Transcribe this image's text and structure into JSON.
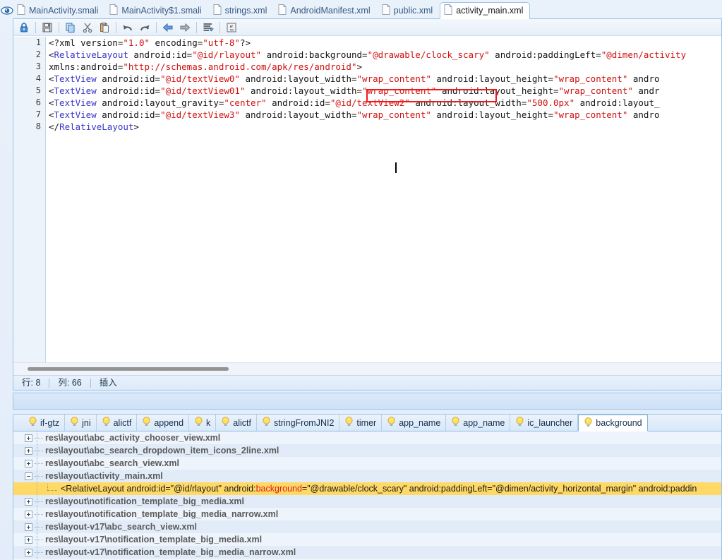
{
  "window": {
    "eye_icon": "eye-icon"
  },
  "tabbar": {
    "tabs": [
      {
        "label": "MainActivity.smali",
        "icon": "file-icon",
        "active": false
      },
      {
        "label": "MainActivity$1.smali",
        "icon": "file-icon",
        "active": false
      },
      {
        "label": "strings.xml",
        "icon": "file-icon",
        "active": false
      },
      {
        "label": "AndroidManifest.xml",
        "icon": "file-icon",
        "active": false
      },
      {
        "label": "public.xml",
        "icon": "file-icon",
        "active": false
      },
      {
        "label": "activity_main.xml",
        "icon": "file-icon",
        "active": true
      }
    ]
  },
  "toolbar": {
    "buttons": [
      {
        "name": "lock-icon",
        "title": "Lock"
      },
      {
        "name": "save-icon",
        "title": "Save"
      },
      {
        "name": "copy-icon",
        "title": "Copy"
      },
      {
        "name": "cut-icon",
        "title": "Cut"
      },
      {
        "name": "paste-icon",
        "title": "Paste"
      },
      {
        "name": "undo-icon",
        "title": "Undo"
      },
      {
        "name": "redo-icon",
        "title": "Redo"
      },
      {
        "name": "back-arrow-icon",
        "title": "Back"
      },
      {
        "name": "forward-arrow-icon",
        "title": "Forward"
      },
      {
        "name": "format-lines-icon",
        "title": "Format"
      },
      {
        "name": "java-icon",
        "title": "Java"
      }
    ]
  },
  "editor": {
    "line_numbers": [
      "1",
      "2",
      "3",
      "4",
      "5",
      "6",
      "7",
      "8"
    ],
    "lines": [
      {
        "n": "1",
        "tokens": [
          {
            "t": "decl",
            "v": "<?xml "
          },
          {
            "t": "attr",
            "v": "version="
          },
          {
            "t": "str",
            "v": "\"1.0\""
          },
          {
            "t": "attr",
            "v": " encoding="
          },
          {
            "t": "str",
            "v": "\"utf-8\""
          },
          {
            "t": "decl",
            "v": "?>"
          }
        ]
      },
      {
        "n": "2",
        "tokens": [
          {
            "t": "punc",
            "v": "<"
          },
          {
            "t": "tag",
            "v": "RelativeLayout"
          },
          {
            "t": "attr",
            "v": " android:id="
          },
          {
            "t": "str",
            "v": "\"@id/rlayout\""
          },
          {
            "t": "attr",
            "v": " android:background="
          },
          {
            "t": "str",
            "v": "\"@drawable/clock_scary\""
          },
          {
            "t": "attr",
            "v": " android:paddingLeft="
          },
          {
            "t": "str",
            "v": "\"@dimen/activity"
          }
        ]
      },
      {
        "n": "3",
        "tokens": [
          {
            "t": "attr",
            "v": "  xmlns:android="
          },
          {
            "t": "str",
            "v": "\"http://schemas.android.com/apk/res/android\""
          },
          {
            "t": "punc",
            "v": ">"
          }
        ]
      },
      {
        "n": "4",
        "tokens": [
          {
            "t": "punc",
            "v": "    <"
          },
          {
            "t": "tag",
            "v": "TextView"
          },
          {
            "t": "attr",
            "v": " android:id="
          },
          {
            "t": "str",
            "v": "\"@id/textView0\""
          },
          {
            "t": "attr",
            "v": " android:layout_width="
          },
          {
            "t": "str",
            "v": "\"wrap_content\""
          },
          {
            "t": "attr",
            "v": " android:layout_height="
          },
          {
            "t": "str",
            "v": "\"wrap_content\""
          },
          {
            "t": "attr",
            "v": " andro"
          }
        ]
      },
      {
        "n": "5",
        "tokens": [
          {
            "t": "punc",
            "v": "    <"
          },
          {
            "t": "tag",
            "v": "TextView"
          },
          {
            "t": "attr",
            "v": " android:id="
          },
          {
            "t": "str",
            "v": "\"@id/textView01\""
          },
          {
            "t": "attr",
            "v": " android:layout_width="
          },
          {
            "t": "str",
            "v": "\"wrap_content\""
          },
          {
            "t": "attr",
            "v": " android:layout_height="
          },
          {
            "t": "str",
            "v": "\"wrap_content\""
          },
          {
            "t": "attr",
            "v": " andr"
          }
        ]
      },
      {
        "n": "6",
        "tokens": [
          {
            "t": "punc",
            "v": "    <"
          },
          {
            "t": "tag",
            "v": "TextView"
          },
          {
            "t": "attr",
            "v": " android:layout_gravity="
          },
          {
            "t": "str",
            "v": "\"center\""
          },
          {
            "t": "attr",
            "v": " android:id="
          },
          {
            "t": "str",
            "v": "\"@id/textView2\""
          },
          {
            "t": "attr",
            "v": " android:layout_width="
          },
          {
            "t": "str",
            "v": "\"500.0px\""
          },
          {
            "t": "attr",
            "v": " android:layout_"
          }
        ]
      },
      {
        "n": "7",
        "tokens": [
          {
            "t": "punc",
            "v": "    <"
          },
          {
            "t": "tag",
            "v": "TextView"
          },
          {
            "t": "attr",
            "v": " android:id="
          },
          {
            "t": "str",
            "v": "\"@id/textView3\""
          },
          {
            "t": "attr",
            "v": " android:layout_width="
          },
          {
            "t": "str",
            "v": "\"wrap_content\""
          },
          {
            "t": "attr",
            "v": " android:layout_height="
          },
          {
            "t": "str",
            "v": "\"wrap_content\""
          },
          {
            "t": "attr",
            "v": " andro"
          }
        ]
      },
      {
        "n": "8",
        "tokens": [
          {
            "t": "punc",
            "v": "</"
          },
          {
            "t": "tag",
            "v": "RelativeLayout"
          },
          {
            "t": "punc",
            "v": ">"
          }
        ]
      }
    ],
    "highlight_box": {
      "text": "\"@drawable/clock_scary\"",
      "color": "#ef1b1b"
    },
    "caret_visible": true
  },
  "statusbar": {
    "line_label": "行: 8",
    "column_label": "列: 66",
    "mode_label": "插入"
  },
  "results": {
    "tabs": [
      {
        "label": "if-gtz",
        "icon": "lightbulb-icon",
        "active": false
      },
      {
        "label": "jni",
        "icon": "lightbulb-icon",
        "active": false
      },
      {
        "label": "alictf",
        "icon": "lightbulb-icon",
        "active": false
      },
      {
        "label": "append",
        "icon": "lightbulb-icon",
        "active": false
      },
      {
        "label": "k",
        "icon": "lightbulb-icon",
        "active": false
      },
      {
        "label": "alictf",
        "icon": "lightbulb-icon",
        "active": false
      },
      {
        "label": "stringFromJNI2",
        "icon": "lightbulb-icon",
        "active": false
      },
      {
        "label": "timer",
        "icon": "lightbulb-icon",
        "active": false
      },
      {
        "label": "app_name",
        "icon": "lightbulb-icon",
        "active": false
      },
      {
        "label": "app_name",
        "icon": "lightbulb-icon",
        "active": false
      },
      {
        "label": "ic_launcher",
        "icon": "lightbulb-icon",
        "active": false
      },
      {
        "label": "background",
        "icon": "lightbulb-icon",
        "active": true
      }
    ],
    "rows": [
      {
        "kind": "file",
        "expanded": false,
        "label": "res\\layout\\abc_activity_chooser_view.xml"
      },
      {
        "kind": "file",
        "expanded": false,
        "label": "res\\layout\\abc_search_dropdown_item_icons_2line.xml"
      },
      {
        "kind": "file",
        "expanded": false,
        "label": "res\\layout\\abc_search_view.xml"
      },
      {
        "kind": "file",
        "expanded": true,
        "label": "res\\layout\\activity_main.xml"
      },
      {
        "kind": "match",
        "segments": [
          {
            "c": "plain",
            "v": "<RelativeLayout android:id=\"@id/rlayout\" android:"
          },
          {
            "c": "red",
            "v": "background"
          },
          {
            "c": "plain",
            "v": " =\"@drawable/clock_scary\" android:paddingLeft=\"@dimen/activity_horizontal_margin\" android:paddin"
          }
        ]
      },
      {
        "kind": "file",
        "expanded": false,
        "label": "res\\layout\\notification_template_big_media.xml"
      },
      {
        "kind": "file",
        "expanded": false,
        "label": "res\\layout\\notification_template_big_media_narrow.xml"
      },
      {
        "kind": "file",
        "expanded": false,
        "label": "res\\layout-v17\\abc_search_view.xml"
      },
      {
        "kind": "file",
        "expanded": false,
        "label": "res\\layout-v17\\notification_template_big_media.xml"
      },
      {
        "kind": "file",
        "expanded": false,
        "label": "res\\layout-v17\\notification_template_big_media_narrow.xml"
      }
    ]
  }
}
